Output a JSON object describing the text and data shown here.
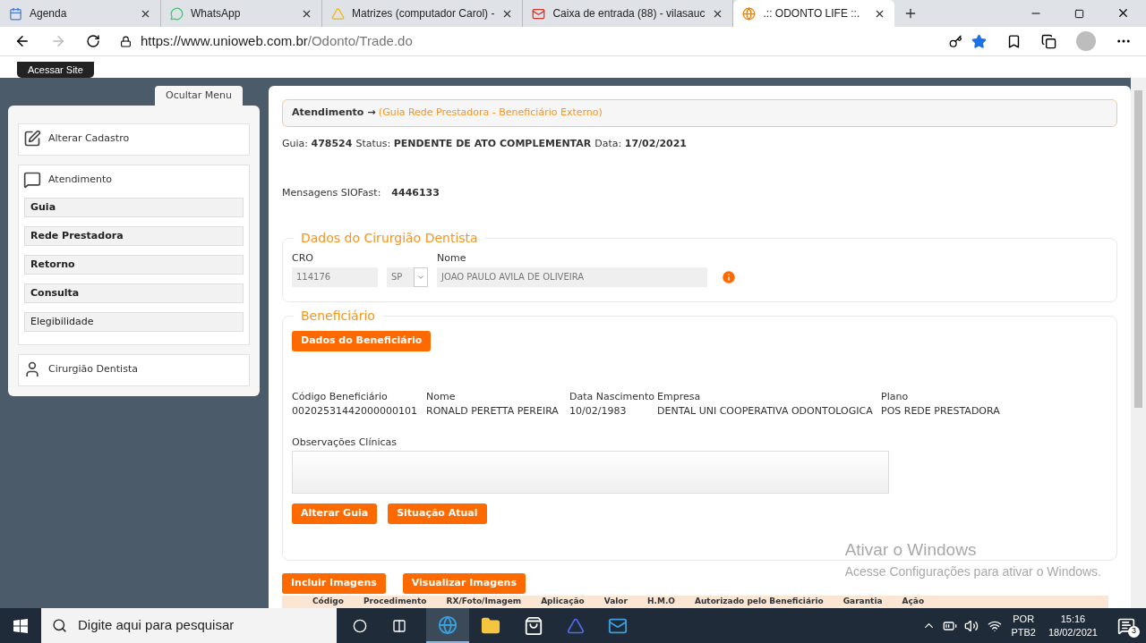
{
  "browser": {
    "tabs": [
      {
        "title": "Agenda",
        "selected": false
      },
      {
        "title": "WhatsApp",
        "selected": false
      },
      {
        "title": "Matrizes (computador Carol) -",
        "selected": false
      },
      {
        "title": "Caixa de entrada (88) - vilasauc",
        "selected": false
      },
      {
        "title": ".:: ODONTO LIFE ::.",
        "selected": true
      }
    ],
    "url_host": "https://www.unioweb.com.br",
    "url_path": "/Odonto/Trade.do",
    "favorite": true
  },
  "site_header": {
    "button": "Acessar Site"
  },
  "sidebar": {
    "toggle": "Ocultar Menu",
    "items": [
      {
        "label": "Alterar Cadastro"
      },
      {
        "label": "Atendimento",
        "children": [
          {
            "label": "Guia",
            "emphasized": true
          },
          {
            "label": "Rede Prestadora",
            "emphasized": true
          },
          {
            "label": "Retorno",
            "emphasized": true
          },
          {
            "label": "Consulta",
            "emphasized": true
          },
          {
            "label": "Elegibilidade",
            "emphasized": false
          }
        ]
      },
      {
        "label": "Cirurgião Dentista"
      }
    ]
  },
  "main": {
    "breadcrumb": {
      "label": "Atendimento",
      "arrow": "→",
      "link": "(Guia Rede Prestadora - Beneficiário Externo)"
    },
    "status_line": [
      {
        "label": "Guia:",
        "value": "478524"
      },
      {
        "label": "Status:",
        "value": "PENDENTE DE ATO COMPLEMENTAR"
      },
      {
        "label": "Data:",
        "value": "17/02/2021"
      }
    ],
    "messages": {
      "label": "Mensagens SIOFast:",
      "value": "4446133"
    },
    "dentist": {
      "title": "Dados do Cirurgião Dentista",
      "cro_label": "CRO",
      "cro": "114176",
      "uf": "SP",
      "name_label": "Nome",
      "name": "JOAO PAULO AVILA DE OLIVEIRA"
    },
    "beneficiary": {
      "title": "Beneficiário",
      "details_button": "Dados do Beneficiário",
      "fields": [
        {
          "label": "Código Beneficiário",
          "value": "00202531442000000101"
        },
        {
          "label": "Nome",
          "value": "RONALD PERETTA PEREIRA"
        },
        {
          "label": "Data Nascimento",
          "value": "10/02/1983"
        },
        {
          "label": "Empresa",
          "value": "DENTAL UNI COOPERATIVA ODONTOLOGICA"
        },
        {
          "label": "Plano",
          "value": "POS REDE PRESTADORA"
        }
      ],
      "notes_label": "Observações Clínicas",
      "buttons": [
        "Alterar Guia",
        "Situação Atual"
      ]
    },
    "image_buttons": [
      "Incluir Imagens",
      "Visualizar Imagens"
    ],
    "table": {
      "columns": [
        "Código",
        "Procedimento",
        "RX/Foto/Imagem",
        "Aplicação",
        "Valor",
        "H.M.O",
        "Autorizado pelo Beneficiário",
        "Garantia",
        "Ação"
      ]
    }
  },
  "activation_notice": {
    "title": "Ativar o Windows",
    "text": "Acesse Configurações para ativar o Windows."
  },
  "taskbar": {
    "search_placeholder": "Digite aqui para pesquisar",
    "language": "POR",
    "layout": "PTB2",
    "time": "15:16",
    "date": "18/02/2021",
    "notifications": "3"
  }
}
